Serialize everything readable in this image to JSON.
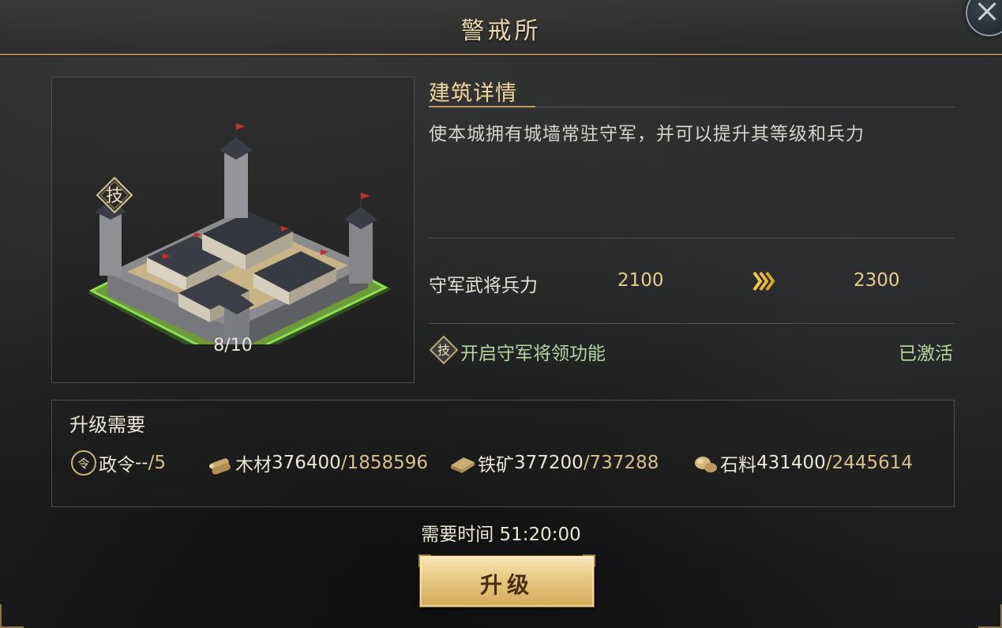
{
  "window": {
    "title": "警戒所"
  },
  "building": {
    "level": "8/10",
    "tech_badge": "技"
  },
  "details": {
    "heading": "建筑详情",
    "description": "使本城拥有城墙常驻守军，并可以提升其等级和兵力"
  },
  "stat": {
    "label": "守军武将兵力",
    "current": "2100",
    "next": "2300"
  },
  "feature": {
    "icon_text": "技",
    "label": "开启守军将领功能",
    "status": "已激活"
  },
  "requirements": {
    "title": "升级需要",
    "items": [
      {
        "icon": "order-icon",
        "icon_text": "令",
        "name": "政令",
        "have": " --",
        "need": "/5"
      },
      {
        "icon": "wood-icon",
        "name": "木材",
        "have": "376400",
        "need": "/1858596"
      },
      {
        "icon": "iron-icon",
        "name": "铁矿",
        "have": "377200",
        "need": "/737288"
      },
      {
        "icon": "stone-icon",
        "name": "石料",
        "have": "431400",
        "need": "/2445614"
      }
    ]
  },
  "time": {
    "text": "需要时间 51:20:00"
  },
  "actions": {
    "upgrade_label": "升级"
  },
  "colors": {
    "gold_text": "#e6cc8d",
    "green_text": "#b6d59f",
    "button_gold": "#e9c982"
  }
}
